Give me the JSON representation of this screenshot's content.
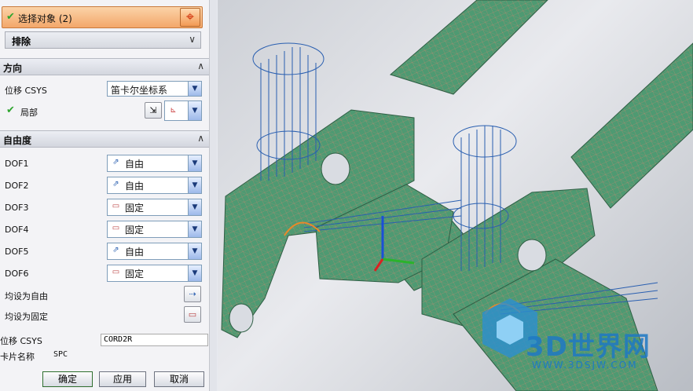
{
  "selection": {
    "label": "选择对象 (2)"
  },
  "exclude": {
    "label": "排除"
  },
  "direction": {
    "section_title": "方向",
    "csys_label": "位移 CSYS",
    "csys_value": "笛卡尔坐标系",
    "local_label": "局部"
  },
  "dof": {
    "section_title": "自由度",
    "rows": [
      {
        "label": "DOF1",
        "value": "自由",
        "icon": "free-icon"
      },
      {
        "label": "DOF2",
        "value": "自由",
        "icon": "free-icon"
      },
      {
        "label": "DOF3",
        "value": "固定",
        "icon": "fixed-icon"
      },
      {
        "label": "DOF4",
        "value": "固定",
        "icon": "fixed-icon"
      },
      {
        "label": "DOF5",
        "value": "自由",
        "icon": "free-icon"
      },
      {
        "label": "DOF6",
        "value": "固定",
        "icon": "fixed-icon"
      }
    ],
    "all_free_label": "均设为自由",
    "all_fixed_label": "均设为固定"
  },
  "info": {
    "csys_label": "位移 CSYS",
    "csys_value": "CORD2R",
    "card_label": "卡片名称",
    "card_value": "SPC"
  },
  "buttons": {
    "ok": "确定",
    "apply": "应用",
    "cancel": "取消"
  },
  "watermark": {
    "title": "3D世界网",
    "url": "WWW.3DSJW.COM"
  },
  "colors": {
    "mesh": "#4e9a72",
    "mesh_line": "#c08a6a",
    "constraint": "#2a5fb0",
    "accent": "#f3a76a"
  }
}
